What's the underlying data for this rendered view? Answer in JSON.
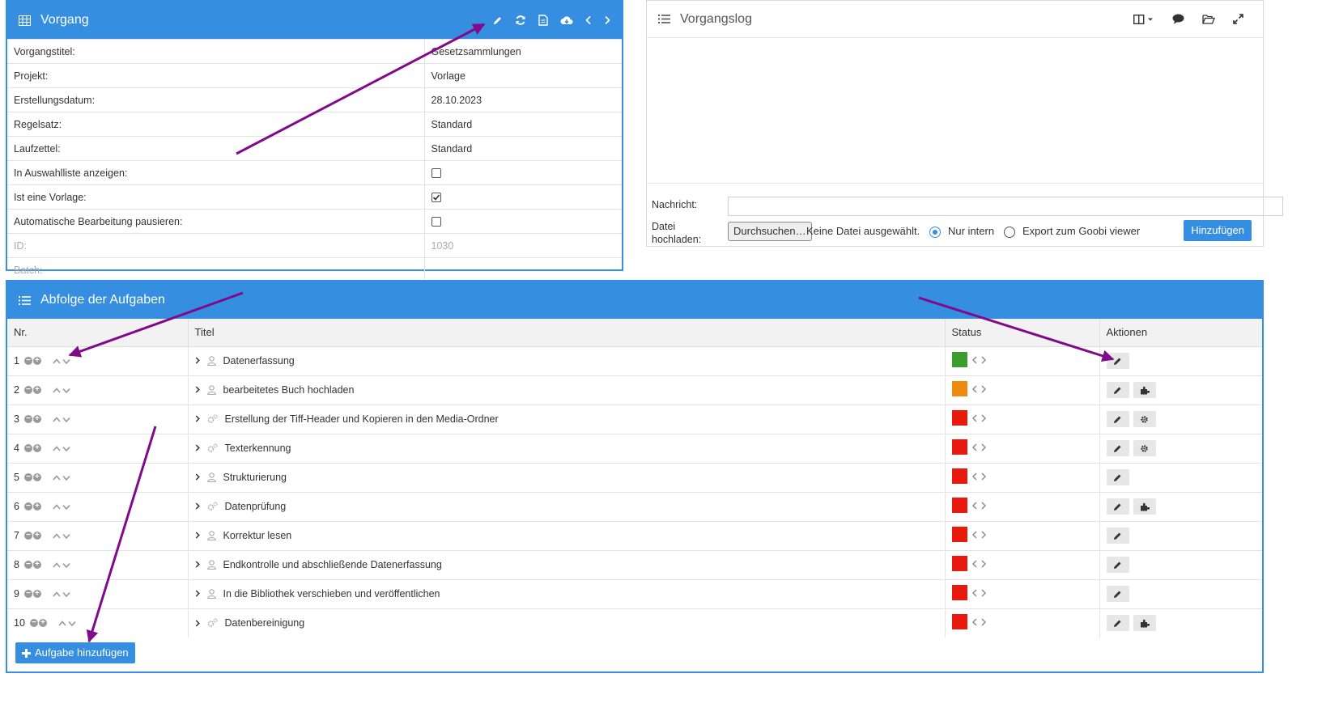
{
  "vorgang": {
    "title": "Vorgang",
    "rows": [
      {
        "label": "Vorgangstitel:",
        "value": "Gesetzsammlungen"
      },
      {
        "label": "Projekt:",
        "value": "Vorlage"
      },
      {
        "label": "Erstellungsdatum:",
        "value": "28.10.2023"
      },
      {
        "label": "Regelsatz:",
        "value": "Standard"
      },
      {
        "label": "Laufzettel:",
        "value": "Standard"
      },
      {
        "label": "In Auswahlliste anzeigen:"
      },
      {
        "label": "Ist eine Vorlage:"
      },
      {
        "label": "Automatische Bearbeitung pausieren:"
      },
      {
        "label": "ID:",
        "value": "1030"
      },
      {
        "label": "Batch:",
        "value": ""
      }
    ]
  },
  "log": {
    "title": "Vorgangslog",
    "message_label": "Nachricht:",
    "upload_label_1": "Datei",
    "upload_label_2": "hochladen:",
    "browse_button": "Durchsuchen…",
    "no_file": "Keine Datei ausgewählt.",
    "radio_internal": "Nur intern",
    "radio_export": "Export zum Goobi viewer",
    "add_button": "Hinzufügen"
  },
  "tasks": {
    "title": "Abfolge der Aufgaben",
    "columns": {
      "nr": "Nr.",
      "title": "Titel",
      "status": "Status",
      "actions": "Aktionen"
    },
    "rows": [
      {
        "nr": "1",
        "title": "Datenerfassung"
      },
      {
        "nr": "2",
        "title": "bearbeitetes Buch hochladen"
      },
      {
        "nr": "3",
        "title": "Erstellung der Tiff-Header und Kopieren in den Media-Ordner"
      },
      {
        "nr": "4",
        "title": "Texterkennung"
      },
      {
        "nr": "5",
        "title": "Strukturierung"
      },
      {
        "nr": "6",
        "title": "Datenprüfung"
      },
      {
        "nr": "7",
        "title": "Korrektur lesen"
      },
      {
        "nr": "8",
        "title": "Endkontrolle und abschließende Datenerfassung"
      },
      {
        "nr": "9",
        "title": "In die Bibliothek verschieben und veröffentlichen"
      },
      {
        "nr": "10",
        "title": "Datenbereinigung"
      }
    ],
    "add_button": "Aufgabe hinzufügen"
  },
  "colors": {
    "accent": "#368ee0",
    "status_done": "#3a9e2f",
    "status_open": "#ee8a10",
    "status_locked": "#e8190d",
    "annotation_arrow": "#800a8a"
  }
}
